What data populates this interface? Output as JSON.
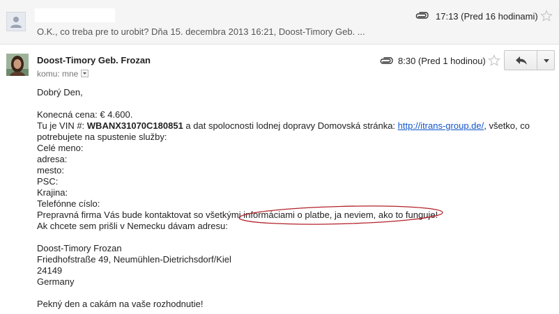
{
  "collapsed_message": {
    "snippet": "O.K., co treba pre to urobit? Dňa 15. decembra 2013 16:21, Doost-Timory Geb. ...",
    "time": "17:13 (Pred 16 hodinami)"
  },
  "expanded_message": {
    "sender_name": "Doost-Timory Geb. Frozan",
    "recipient_label": "komu: mne",
    "time": "8:30 (Pred 1 hodinou)",
    "body": {
      "greeting": "Dobrý Den,",
      "price": "Konecná cena: € 4.600.",
      "vin_prefix": "Tu je VIN #: ",
      "vin_number": "WBANX31070C180851",
      "vin_middle": " a dat spolocnosti lodnej dopravy Domovská stránka: ",
      "vin_link": "http://itrans-group.de/",
      "vin_suffix": ", všetko, co",
      "vin_line2": "potrebujete na spustenie služby:",
      "field_name": "Celé meno:",
      "field_address": "adresa:",
      "field_city": "mesto:",
      "field_zip": "PSC:",
      "field_country": "Krajina:",
      "field_phone": "Telefónne císlo:",
      "shipping_before": "Prepravná firma Vás bude kontaktovat so všetkými ",
      "shipping_highlight": "informáciami o platbe, ja neviem, ako to funguje!",
      "germany_line": "Ak chcete sem prišli v Nemecku dávam adresu:",
      "addr_name": "Doost-Timory Frozan",
      "addr_street": "Friedhofstraße 49, Neumühlen-Dietrichsdorf/Kiel",
      "addr_zip": "24149",
      "addr_country": "Germany",
      "closing": "Pekný den a cakám na vaše rozhodnutie!"
    }
  },
  "colors": {
    "link": "#1155cc",
    "collapsed_bg": "#f5f5f5",
    "highlight_ellipse": "#b3202a",
    "star_outline": "#c9c9c9"
  },
  "icons": {
    "default_avatar": "person-silhouette-icon",
    "attachment": "paperclip-icon",
    "star": "star-outline-icon",
    "reply": "reply-arrow-icon",
    "more": "chevron-down-icon",
    "recipient_details": "dropdown-arrow-icon"
  }
}
